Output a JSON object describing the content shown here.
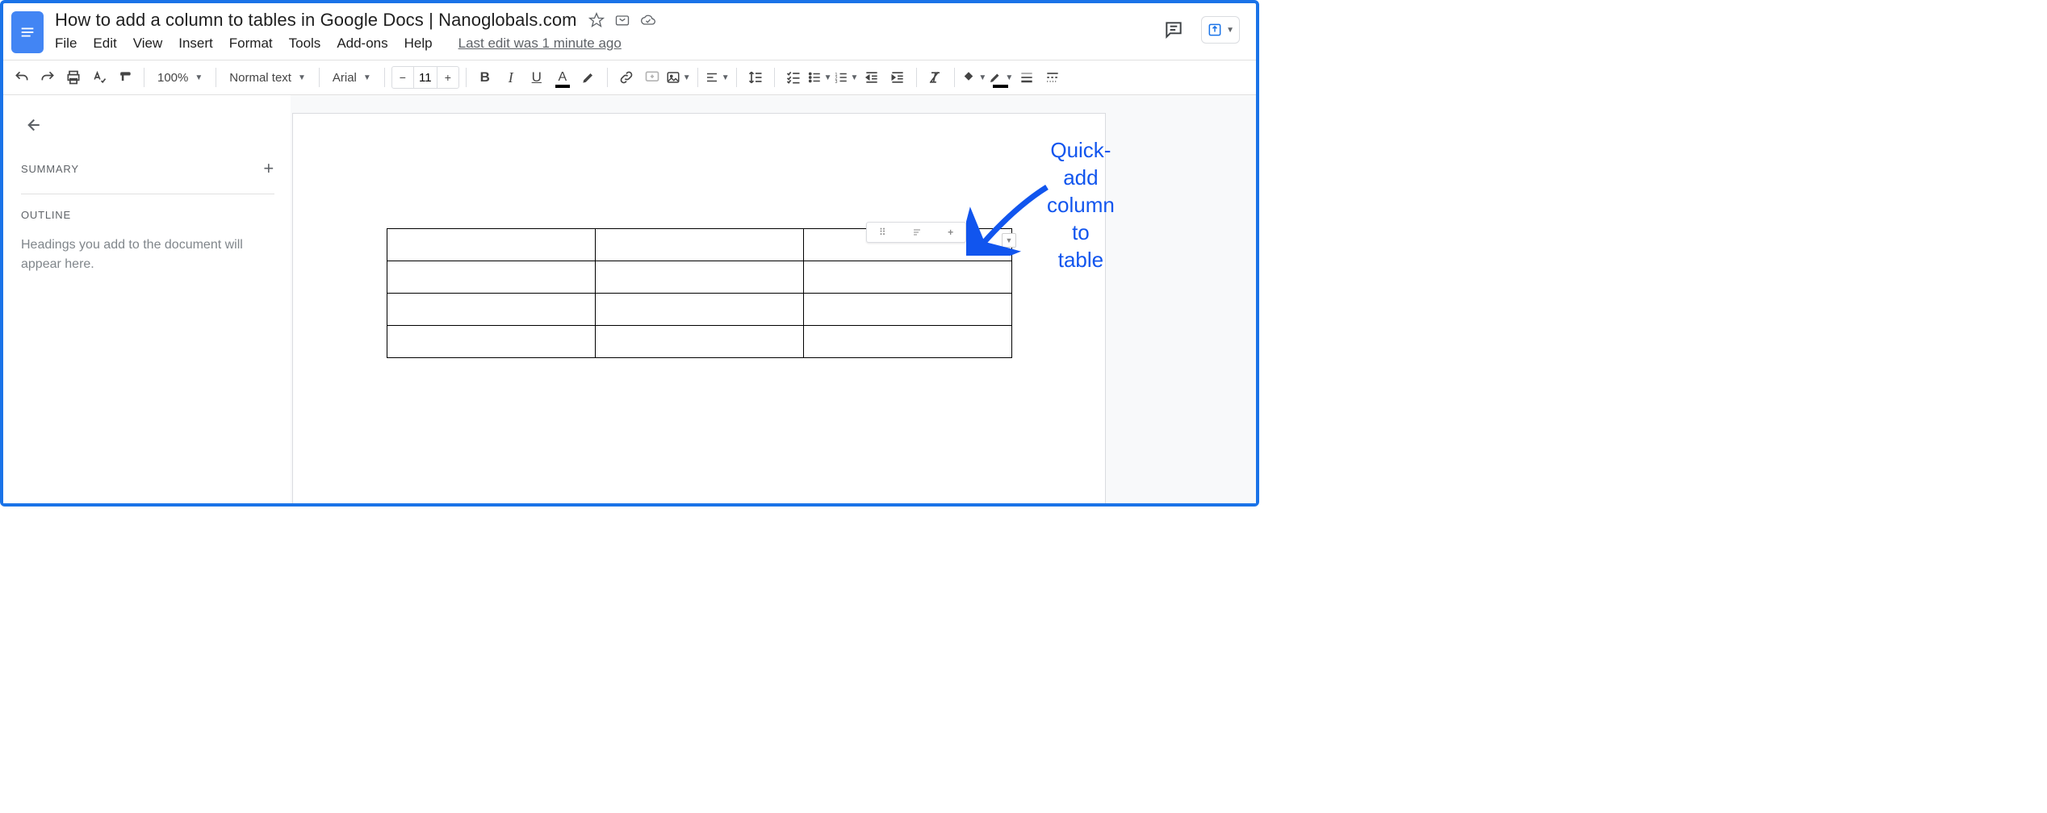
{
  "header": {
    "title": "How to add a column to tables in Google Docs | Nanoglobals.com",
    "last_edit": "Last edit was 1 minute ago"
  },
  "menu": {
    "file": "File",
    "edit": "Edit",
    "view": "View",
    "insert": "Insert",
    "format": "Format",
    "tools": "Tools",
    "addons": "Add-ons",
    "help": "Help"
  },
  "toolbar": {
    "zoom": "100%",
    "style": "Normal text",
    "font": "Arial",
    "font_size": "11"
  },
  "sidebar": {
    "summary_label": "SUMMARY",
    "outline_label": "OUTLINE",
    "outline_hint": "Headings you add to the document will appear here."
  },
  "table": {
    "rows": 4,
    "cols": 3
  },
  "annotation": {
    "line1": "Quick-add",
    "line2": "column to",
    "line3": "table"
  }
}
